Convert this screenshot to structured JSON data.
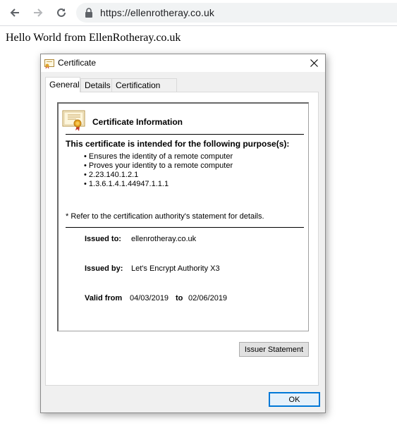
{
  "browser": {
    "url": "https://ellenrotheray.co.uk",
    "icons": {
      "back": "arrow-left-icon",
      "forward": "arrow-right-icon",
      "reload": "reload-icon",
      "secure": "lock-icon"
    }
  },
  "page": {
    "text": "Hello World from EllenRotheray.co.uk"
  },
  "dialog": {
    "title": "Certificate",
    "close": "×",
    "tabs": [
      "General",
      "Details",
      "Certification Path"
    ],
    "info_heading": "Certificate Information",
    "purpose_heading": "This certificate is intended for the following purpose(s):",
    "purposes": [
      "Ensures the identity of a remote computer",
      "Proves your identity to a remote computer",
      "2.23.140.1.2.1",
      "1.3.6.1.4.1.44947.1.1.1"
    ],
    "refer_note": "* Refer to the certification authority's statement for details.",
    "issued_to_label": "Issued to:",
    "issued_to": "ellenrotheray.co.uk",
    "issued_by_label": "Issued by:",
    "issued_by": "Let's Encrypt Authority X3",
    "valid_from_label": "Valid from",
    "valid_from": "04/03/2019",
    "valid_to_label": "to",
    "valid_to": "02/06/2019",
    "issuer_statement_button": "Issuer Statement",
    "ok_button": "OK"
  }
}
